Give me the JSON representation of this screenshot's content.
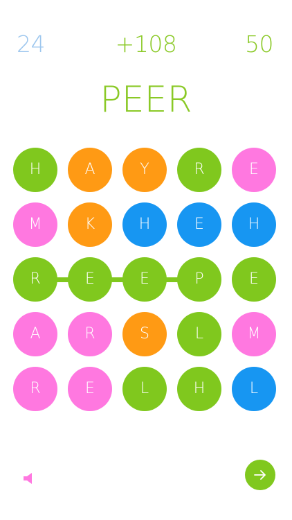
{
  "header": {
    "moves_left": "24",
    "word_points": "+108",
    "total_score": "50"
  },
  "current_word": "PEER",
  "colors": {
    "green": "#80c81e",
    "orange": "#ff9a14",
    "blue": "#1796f2",
    "pink": "#ff78e0",
    "score_green": "#8ac926",
    "moves_blue": "#9cc6ee"
  },
  "board": [
    [
      {
        "letter": "H",
        "color": "green"
      },
      {
        "letter": "A",
        "color": "orange"
      },
      {
        "letter": "Y",
        "color": "orange"
      },
      {
        "letter": "R",
        "color": "green"
      },
      {
        "letter": "E",
        "color": "pink"
      }
    ],
    [
      {
        "letter": "M",
        "color": "pink"
      },
      {
        "letter": "K",
        "color": "orange"
      },
      {
        "letter": "H",
        "color": "blue"
      },
      {
        "letter": "E",
        "color": "blue"
      },
      {
        "letter": "H",
        "color": "blue"
      }
    ],
    [
      {
        "letter": "R",
        "color": "green"
      },
      {
        "letter": "E",
        "color": "green"
      },
      {
        "letter": "E",
        "color": "green"
      },
      {
        "letter": "P",
        "color": "green"
      },
      {
        "letter": "E",
        "color": "green"
      }
    ],
    [
      {
        "letter": "A",
        "color": "pink"
      },
      {
        "letter": "R",
        "color": "pink"
      },
      {
        "letter": "S",
        "color": "orange"
      },
      {
        "letter": "L",
        "color": "green"
      },
      {
        "letter": "M",
        "color": "pink"
      }
    ],
    [
      {
        "letter": "R",
        "color": "pink"
      },
      {
        "letter": "E",
        "color": "pink"
      },
      {
        "letter": "L",
        "color": "green"
      },
      {
        "letter": "H",
        "color": "green"
      },
      {
        "letter": "L",
        "color": "blue"
      }
    ]
  ],
  "selected_path": [
    [
      2,
      0
    ],
    [
      2,
      1
    ],
    [
      2,
      2
    ],
    [
      2,
      3
    ]
  ],
  "controls": {
    "sound_icon": "speaker-icon",
    "next_icon": "arrow-right-icon"
  }
}
